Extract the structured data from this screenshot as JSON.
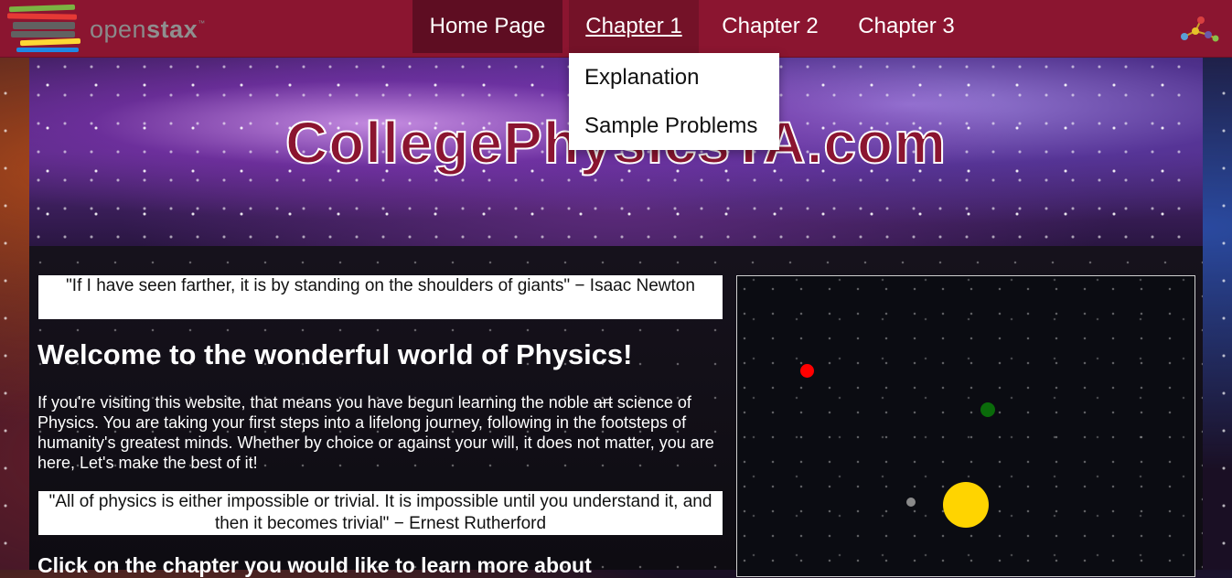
{
  "navbar": {
    "logo_text_light": "open",
    "logo_text_bold": "stax",
    "logo_tm": "™",
    "items": [
      {
        "label": "Home Page"
      },
      {
        "label": "Chapter 1"
      },
      {
        "label": "Chapter 2"
      },
      {
        "label": "Chapter 3"
      }
    ],
    "dropdown": [
      {
        "label": "Explanation"
      },
      {
        "label": "Sample Problems"
      }
    ],
    "logo_book_colors": [
      "#7bb342",
      "#e53935",
      "#616161",
      "#fdd835",
      "#1e88e5"
    ],
    "network_icon": "network-icon"
  },
  "banner": {
    "title": "CollegePhysicsTA.com"
  },
  "main": {
    "quote1": "\"If I have seen farther, it is by standing on the shoulders of giants\" − Isaac Newton",
    "welcome": "Welcome to the wonderful world of Physics!",
    "intro_before": "If you're visiting this website, that means you have begun learning the noble ",
    "intro_struck": "art",
    "intro_after": " science of Physics. You are taking your first steps into a lifelong journey, following in the footsteps of humanity's greatest minds. Whether by choice or against your will, it does not matter, you are here, Let's make the best of it!",
    "quote2": "\"All of physics is either impossible or trivial. It is impossible until you understand it, and then it becomes trivial\" − Ernest Rutherford",
    "chapter_prompt": "Click on the chapter you would like to learn more about"
  },
  "simulation": {
    "bodies": [
      {
        "name": "red-planet",
        "color": "#ff0000"
      },
      {
        "name": "green-planet",
        "color": "#0a6b0a"
      },
      {
        "name": "gray-planet",
        "color": "#8a8a8a"
      },
      {
        "name": "sun",
        "color": "#ffd400"
      }
    ]
  },
  "colors": {
    "nav_bg": "#8b1530",
    "nav_active": "#5e0d22",
    "banner_title": "#8b1530"
  }
}
